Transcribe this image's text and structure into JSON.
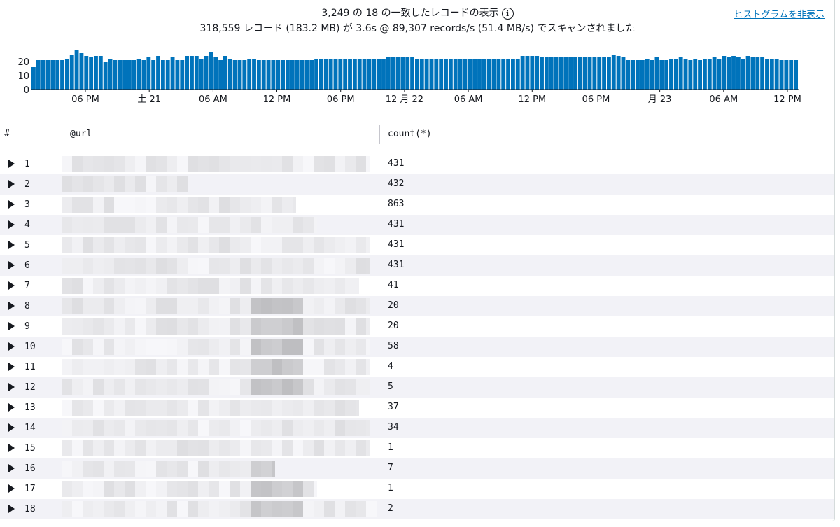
{
  "summary": {
    "matched_line": "3,249 の 18 の一致したレコードの表示",
    "scan_line": "318,559 レコード (183.2 MB) が 3.6s @ 89,307 records/s (51.4 MB/s) でスキャンされました"
  },
  "histogram_toggle": "ヒストグラムを非表示",
  "chart_data": {
    "type": "bar",
    "ylim": [
      0,
      32
    ],
    "y_ticks": [
      "0",
      "10",
      "20"
    ],
    "x_tick_labels": [
      "06 PM",
      "土 21",
      "06 AM",
      "12 PM",
      "06 PM",
      "12 月 22",
      "06 AM",
      "12 PM",
      "06 PM",
      "月 23",
      "06 AM",
      "12 PM"
    ],
    "color": "#0073bb",
    "values": [
      16,
      21,
      21,
      21,
      21,
      21,
      21,
      22,
      25,
      28,
      26,
      24,
      23,
      24,
      24,
      20,
      22,
      21,
      21,
      21,
      21,
      21,
      22,
      21,
      23,
      21,
      24,
      21,
      21,
      23,
      21,
      21,
      24,
      24,
      24,
      22,
      24,
      27,
      23,
      21,
      24,
      22,
      21,
      21,
      21,
      22,
      22,
      21,
      21,
      21,
      21,
      21,
      21,
      21,
      21,
      21,
      21,
      21,
      21,
      22,
      22,
      22,
      22,
      22,
      22,
      22,
      22,
      22,
      22,
      22,
      22,
      22,
      22,
      22,
      23,
      23,
      23,
      23,
      23,
      23,
      22,
      22,
      22,
      22,
      22,
      22,
      22,
      22,
      22,
      22,
      22,
      22,
      22,
      22,
      22,
      22,
      22,
      22,
      22,
      22,
      22,
      22,
      24,
      24,
      24,
      24,
      23,
      23,
      23,
      23,
      23,
      23,
      23,
      23,
      23,
      23,
      23,
      23,
      23,
      23,
      23,
      25,
      24,
      23,
      21,
      21,
      21,
      21,
      22,
      21,
      23,
      21,
      21,
      22,
      22,
      23,
      22,
      21,
      22,
      21,
      22,
      22,
      23,
      22,
      24,
      23,
      24,
      23,
      22,
      24,
      23,
      23,
      23,
      22,
      22,
      22,
      21,
      21,
      21,
      21
    ]
  },
  "table": {
    "columns": [
      "#",
      "@url",
      "count(*)"
    ],
    "rows": [
      {
        "idx": "1",
        "count": "431"
      },
      {
        "idx": "2",
        "count": "432"
      },
      {
        "idx": "3",
        "count": "863"
      },
      {
        "idx": "4",
        "count": "431"
      },
      {
        "idx": "5",
        "count": "431"
      },
      {
        "idx": "6",
        "count": "431"
      },
      {
        "idx": "7",
        "count": "41"
      },
      {
        "idx": "8",
        "count": "20"
      },
      {
        "idx": "9",
        "count": "20"
      },
      {
        "idx": "10",
        "count": "58"
      },
      {
        "idx": "11",
        "count": "4"
      },
      {
        "idx": "12",
        "count": "5"
      },
      {
        "idx": "13",
        "count": "37"
      },
      {
        "idx": "14",
        "count": "34"
      },
      {
        "idx": "15",
        "count": "1"
      },
      {
        "idx": "16",
        "count": "7"
      },
      {
        "idx": "17",
        "count": "1"
      },
      {
        "idx": "18",
        "count": "2"
      }
    ]
  }
}
